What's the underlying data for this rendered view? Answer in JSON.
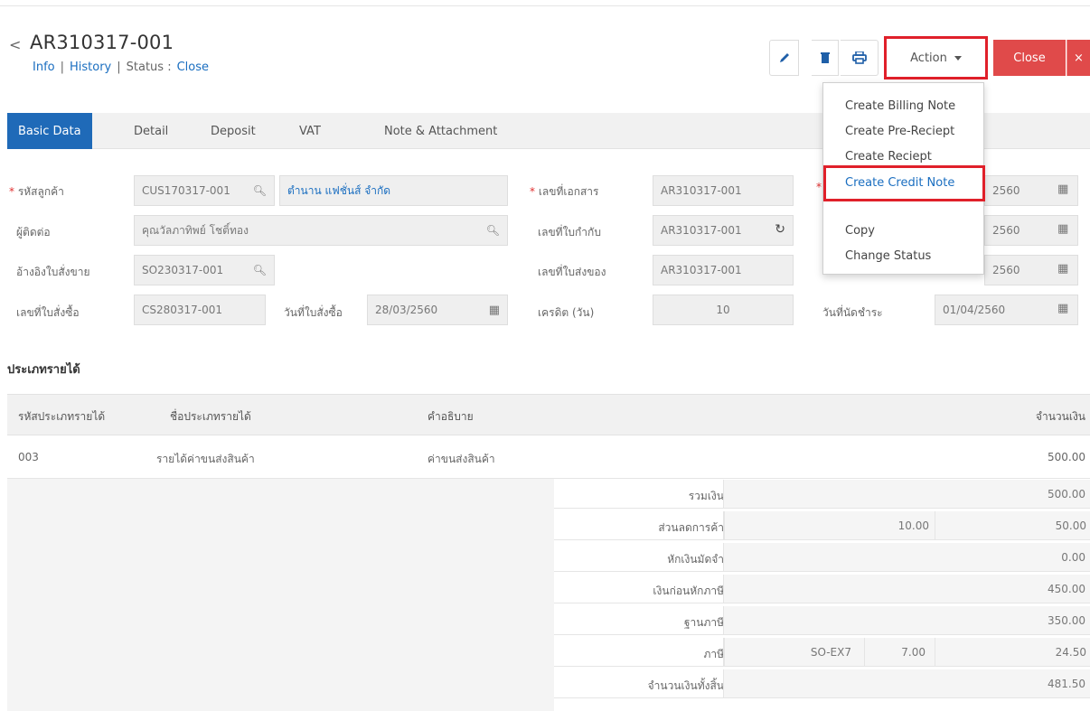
{
  "header": {
    "doc_no": "AR310317-001",
    "links": {
      "info": "Info",
      "history": "History",
      "status_label": "Status :",
      "status_value": "Close"
    },
    "action_label": "Action",
    "close_label": "Close",
    "close_x": "×"
  },
  "action_menu": {
    "items": [
      "Create Billing Note",
      "Create Pre-Reciept",
      "Create Reciept",
      "Create Credit Note",
      "Copy",
      "Change Status"
    ]
  },
  "tabs": [
    "Basic Data",
    "Detail",
    "Deposit",
    "VAT",
    "Note & Attachment"
  ],
  "form": {
    "customer_code": {
      "label": "รหัสลูกค้า",
      "value": "CUS170317-001",
      "name": "ตำนาน แฟชั่นส์ จำกัด"
    },
    "contact": {
      "label": "ผู้ติดต่อ",
      "value": "คุณวัลภาทิพย์ โชติ์ทอง"
    },
    "sales_order_ref": {
      "label": "อ้างอิงใบสั่งขาย",
      "value": "SO230317-001"
    },
    "po_no": {
      "label": "เลขที่ใบสั่งซื้อ",
      "value": "CS280317-001"
    },
    "po_date": {
      "label": "วันที่ใบสั่งซื้อ",
      "value": "28/03/2560"
    },
    "doc_no": {
      "label": "เลขที่เอกสาร",
      "value": "AR310317-001"
    },
    "tax_invoice_no": {
      "label": "เลขที่ใบกำกับ",
      "value": "AR310317-001"
    },
    "delivery_no": {
      "label": "เลขที่ใบส่งของ",
      "value": "AR310317-001"
    },
    "credit_days": {
      "label": "เครดิต (วัน)",
      "value": "10"
    },
    "due_date": {
      "label": "วันที่นัดชำระ",
      "value": "01/04/2560"
    },
    "date1": "2560",
    "date2": "2560",
    "date3": "2560"
  },
  "revenue": {
    "section_title": "ประเภทรายได้",
    "columns": [
      "รหัสประเภทรายได้",
      "ชื่อประเภทรายได้",
      "คำอธิบาย",
      "จำนวนเงิน"
    ],
    "row": {
      "code": "003",
      "name": "รายได้ค่าขนส่งสินค้า",
      "desc": "ค่าขนส่งสินค้า",
      "amount": "500.00"
    }
  },
  "summary": {
    "total": {
      "label": "รวมเงิน",
      "value": "500.00"
    },
    "discount": {
      "label": "ส่วนลดการค้า",
      "percent": "10.00",
      "value": "50.00"
    },
    "deposit": {
      "label": "หักเงินมัดจำ",
      "value": "0.00"
    },
    "before_tax": {
      "label": "เงินก่อนหักภาษี",
      "value": "450.00"
    },
    "tax_base": {
      "label": "ฐานภาษี",
      "value": "350.00"
    },
    "tax": {
      "label": "ภาษี",
      "code": "SO-EX7",
      "rate": "7.00",
      "value": "24.50"
    },
    "grand_total": {
      "label": "จำนวนเงินทั้งสิ้น",
      "value": "481.50"
    }
  }
}
